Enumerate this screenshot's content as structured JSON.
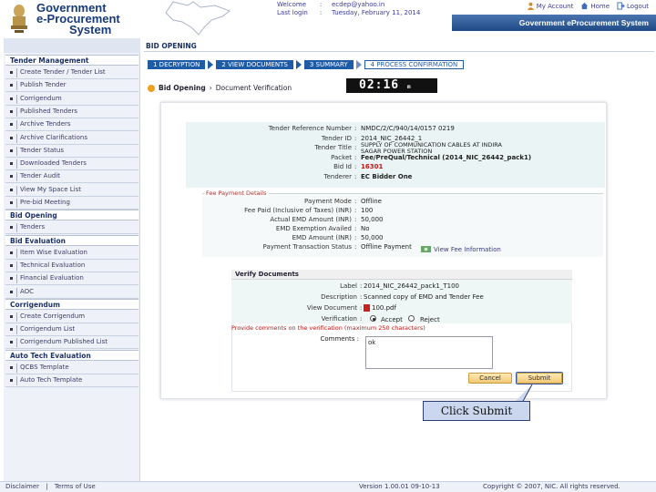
{
  "header": {
    "logo_line1": "Government",
    "logo_line2": "e-Procurement",
    "logo_line3": "System",
    "welcome_label": "Welcome",
    "welcome_value": "ecdep@yahoo.in",
    "last_login_label": "Last login",
    "last_login_value": "Tuesday, February 11, 2014",
    "colon": ":",
    "my_account": "My Account",
    "home": "Home",
    "logout": "Logout",
    "system_title": "Government eProcurement System"
  },
  "sidebar": {
    "sections": [
      {
        "title": "Tender Management",
        "items": [
          "Create Tender / Tender List",
          "Publish Tender",
          "Corrigendum",
          "Published Tenders",
          "Archive Tenders",
          "Archive Clarifications",
          "Tender Status",
          "Downloaded Tenders",
          "Tender Audit",
          "View My Space List",
          "Pre-bid Meeting"
        ]
      },
      {
        "title": "Bid Opening",
        "items": [
          "Tenders"
        ]
      },
      {
        "title": "Bid Evaluation",
        "items": [
          "Item Wise Evaluation",
          "Technical Evaluation",
          "Financial Evaluation",
          "AOC"
        ]
      },
      {
        "title": "Corrigendum",
        "items": [
          "Create Corrigendum",
          "Corrigendum List",
          "Corrigendum Published List"
        ]
      },
      {
        "title": "Auto Tech Evaluation",
        "items": [
          "QCBS Template",
          "Auto Tech Template"
        ]
      }
    ]
  },
  "main": {
    "page_title": "BID OPENING",
    "steps": [
      "1 DECRYPTION",
      "2 VIEW DOCUMENTS",
      "3 SUMMARY",
      "4 PROCESS CONFIRMATION"
    ],
    "breadcrumb_1": "Bid Opening",
    "breadcrumb_sep": "›",
    "breadcrumb_2": "Document Verification",
    "timer": "02:16",
    "timer_unit": "m",
    "tender_fields": [
      {
        "label": "Tender Reference Number",
        "value": "NMDC/2/C/940/14/0157 0219"
      },
      {
        "label": "Tender ID",
        "value": "2014_NIC_26442_1"
      },
      {
        "label": "Tender Title",
        "value": "SUPPLY OF COMMUNICATION CABLES AT INDIRA SAGAR POWER STATION"
      },
      {
        "label": "Packet",
        "value": "Fee/PreQual/Technical (2014_NIC_26442_pack1)"
      },
      {
        "label": "Bid Id",
        "value": "16301"
      },
      {
        "label": "Tenderer",
        "value": "EC Bidder One"
      }
    ],
    "fee_legend": "Fee Payment Details",
    "fee_fields": [
      {
        "label": "Payment Mode",
        "value": "Offline"
      },
      {
        "label": "Fee Paid (Inclusive of Taxes) (INR)",
        "value": "100"
      },
      {
        "label": "Actual EMD Amount (INR)",
        "value": "50,000"
      },
      {
        "label": "EMD Exemption Availed",
        "value": "No"
      },
      {
        "label": "EMD Amount (INR)",
        "value": "50,000"
      },
      {
        "label": "Payment Transaction Status",
        "value": "Offline Payment"
      }
    ],
    "view_fee_info": "View Fee Information",
    "verify_title": "Verify Documents",
    "verify_fields": [
      {
        "label": "Label",
        "value": "2014_NIC_26442_pack1_T100"
      },
      {
        "label": "Description",
        "value": "Scanned copy of EMD and Tender Fee"
      },
      {
        "label": "View Document",
        "value": "100.pdf"
      },
      {
        "label": "Verification",
        "value": ""
      }
    ],
    "accept_label": "Accept",
    "reject_label": "Reject",
    "comments_note": "Provide comments on the verification (maximum 250 characters)",
    "comments_label": "Comments",
    "comments_value": "ok",
    "cancel_label": "Cancel",
    "submit_label": "Submit",
    "callout_text": "Click Submit"
  },
  "footer": {
    "disclaimer": "Disclaimer",
    "footer_sep": "|",
    "terms": "Terms of Use",
    "version": "Version 1.00.01 09-10-13",
    "copyright": "Copyright © 2007, NIC. All rights reserved."
  },
  "colors": {
    "accent": "#1f5ca8",
    "brand": "#163a7a",
    "alert": "#c21515"
  }
}
